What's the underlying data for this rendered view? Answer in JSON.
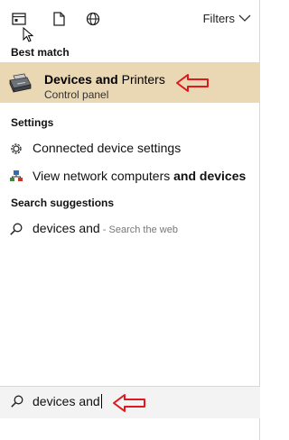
{
  "toolbar": {
    "icons": [
      "apps-icon",
      "document-icon",
      "web-icon"
    ],
    "filters_label": "Filters"
  },
  "best_match": {
    "heading": "Best match",
    "item": {
      "title_bold": "Devices and",
      "title_rest": " Printers",
      "subtitle": "Control panel"
    }
  },
  "settings": {
    "heading": "Settings",
    "items": [
      {
        "label": "Connected device settings",
        "icon": "gear-icon"
      },
      {
        "label_plain": "View network computers ",
        "label_bold": "and devices",
        "icon": "network-icon"
      }
    ]
  },
  "suggestions": {
    "heading": "Search suggestions",
    "items": [
      {
        "label": "devices and",
        "hint": " - Search the web",
        "icon": "search-icon"
      }
    ]
  },
  "search": {
    "value": "devices and"
  },
  "colors": {
    "highlight": "#ead7b3",
    "annotation_arrow": "#e0191f"
  }
}
